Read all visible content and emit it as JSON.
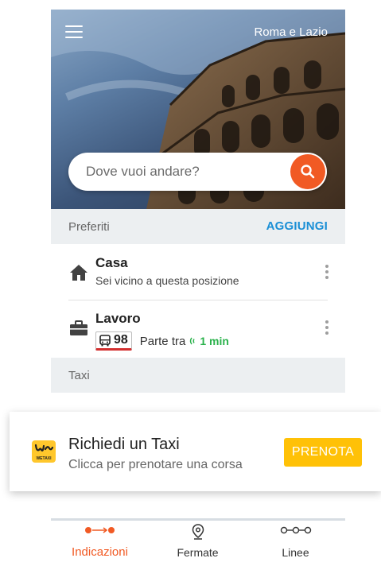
{
  "header": {
    "region": "Roma e Lazio"
  },
  "search": {
    "placeholder": "Dove vuoi andare?"
  },
  "favorites": {
    "title": "Preferiti",
    "add_label": "AGGIUNGI",
    "items": [
      {
        "name": "Casa",
        "subtitle": "Sei vicino a questa posizione",
        "icon": "home-icon"
      },
      {
        "name": "Lavoro",
        "line": "98",
        "departs_label": "Parte tra",
        "eta": "1 min",
        "icon": "briefcase-icon"
      }
    ]
  },
  "taxi": {
    "section_title": "Taxi",
    "card": {
      "logo_text": "WETAXI",
      "title": "Richiedi un Taxi",
      "subtitle": "Clicca per prenotare una corsa",
      "button_label": "PRENOTA"
    }
  },
  "bottom_nav": {
    "items": [
      {
        "label": "Indicazioni",
        "icon": "directions-icon",
        "active": true
      },
      {
        "label": "Fermate",
        "icon": "stop-pin-icon",
        "active": false
      },
      {
        "label": "Linee",
        "icon": "lines-icon",
        "active": false
      }
    ]
  },
  "colors": {
    "accent": "#f15a24",
    "link": "#1a8fd6",
    "eta_green": "#2bb24c",
    "taxi_yellow": "#ffc107",
    "bus_underline": "#d32f2f"
  }
}
